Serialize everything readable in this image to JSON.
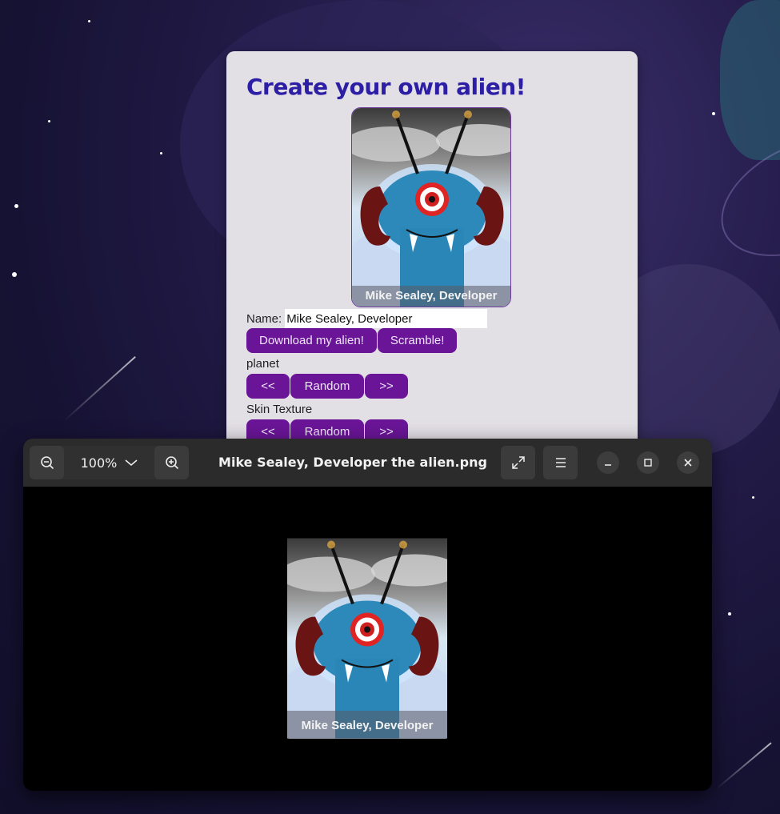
{
  "app": {
    "title": "Create your own alien!",
    "alien_caption": "Mike Sealey, Developer",
    "name_label": "Name:",
    "name_value": "Mike Sealey, Developer",
    "download_label": "Download my alien!",
    "scramble_label": "Scramble!",
    "sections": [
      {
        "label": "planet",
        "prev": "<<",
        "random": "Random",
        "next": ">>"
      },
      {
        "label": "Skin Texture",
        "prev": "<<",
        "random": "Random",
        "next": ">>"
      }
    ],
    "colors": {
      "title": "#2d1fa5",
      "button": "#6a1597",
      "card": "#e2dfe5"
    }
  },
  "viewer": {
    "zoom_value": "100%",
    "file_title": "Mike Sealey, Developer the alien.png",
    "image_caption": "Mike Sealey, Developer",
    "icons": [
      "zoom-out-icon",
      "chevron-down-icon",
      "zoom-in-icon",
      "fullscreen-icon",
      "menu-icon",
      "minimize-icon",
      "maximize-icon",
      "close-icon"
    ]
  }
}
